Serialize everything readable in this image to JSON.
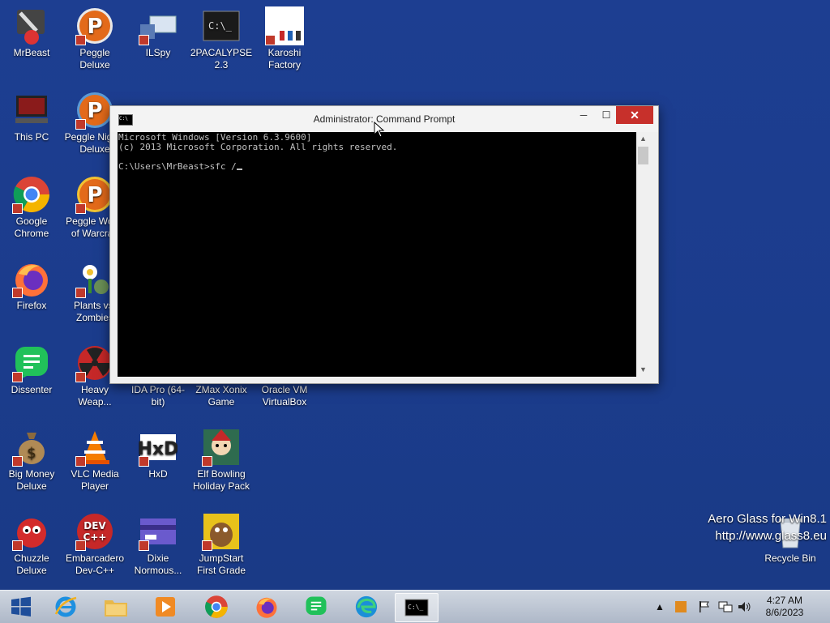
{
  "desktop": {
    "icons": [
      {
        "label": "MrBeast",
        "icon": "mrbeast-icon"
      },
      {
        "label": "Peggle Deluxe",
        "icon": "peggle-icon"
      },
      {
        "label": "ILSpy",
        "icon": "ilspy-icon"
      },
      {
        "label": "2PACALYPSE 2.3",
        "icon": "cmd-icon"
      },
      {
        "label": "Karoshi Factory",
        "icon": "karoshi-icon"
      },
      {
        "label": "This PC",
        "icon": "computer-icon"
      },
      {
        "label": "Peggle Nights Deluxe",
        "icon": "peggle-icon"
      },
      {
        "label": "Google Chrome",
        "icon": "chrome-icon"
      },
      {
        "label": "Peggle World of Warcraft",
        "icon": "peggle-icon"
      },
      {
        "label": "Firefox",
        "icon": "firefox-icon"
      },
      {
        "label": "Plants vs. Zombies",
        "icon": "plants-icon"
      },
      {
        "label": "Dissenter",
        "icon": "dissenter-icon"
      },
      {
        "label": "Heavy Weap...",
        "icon": "radiation-icon"
      },
      {
        "label": "IDA Pro (64-bit)",
        "icon": "ida-icon"
      },
      {
        "label": "ZMax Xonix Game",
        "icon": "game-icon"
      },
      {
        "label": "Oracle VM VirtualBox",
        "icon": "virtualbox-icon"
      },
      {
        "label": "Big Money Deluxe",
        "icon": "money-bag-icon"
      },
      {
        "label": "VLC Media Player",
        "icon": "vlc-icon"
      },
      {
        "label": "HxD",
        "icon": "hxd-icon"
      },
      {
        "label": "Elf Bowling Holiday Pack",
        "icon": "elf-icon"
      },
      {
        "label": "Chuzzle Deluxe",
        "icon": "chuzzle-icon"
      },
      {
        "label": "Embarcadero Dev-C++",
        "icon": "devcpp-icon"
      },
      {
        "label": "Dixie Normous...",
        "icon": "dixie-icon"
      },
      {
        "label": "JumpStart First Grade",
        "icon": "jumpstart-icon"
      },
      {
        "label": "Recycle Bin",
        "icon": "recycle-bin-icon"
      }
    ]
  },
  "cmd": {
    "title": "Administrator: Command Prompt",
    "lines": [
      "Microsoft Windows [Version 6.3.9600]",
      "(c) 2013 Microsoft Corporation. All rights reserved.",
      "",
      "C:\\Users\\MrBeast>sfc /"
    ],
    "min_label": "─",
    "max_label": "☐",
    "close_label": "✕"
  },
  "aero": {
    "line1": "Aero Glass for Win8.1",
    "line2": "http://www.glass8.eu"
  },
  "taskbar": {
    "items": [
      "start",
      "internet-explorer",
      "file-explorer",
      "media-player",
      "chrome",
      "firefox",
      "dissenter",
      "edge",
      "command-prompt"
    ],
    "tray_up": "▲",
    "time": "4:27 AM",
    "date": "8/6/2023"
  },
  "colors": {
    "desktop": "#1d3e91",
    "close": "#c7302b",
    "taskbar": "#bcc5d3"
  }
}
